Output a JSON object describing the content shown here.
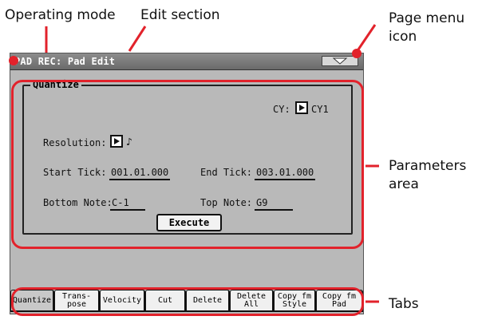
{
  "callouts": {
    "operating_mode": "Operating mode",
    "edit_section": "Edit section",
    "page_menu_icon_line1": "Page menu",
    "page_menu_icon_line2": "icon",
    "parameters_area_line1": "Parameters",
    "parameters_area_line2": "area",
    "tabs": "Tabs"
  },
  "screen": {
    "title": "PAD REC: Pad Edit",
    "panel_title": "Quantize",
    "cy_label": "CY:",
    "cy_value": "CY1",
    "resolution_label": "Resolution:",
    "resolution_value": "♪",
    "start_tick_label": "Start Tick:",
    "start_tick_value": "001.01.000",
    "end_tick_label": "End Tick:",
    "end_tick_value": "003.01.000",
    "bottom_note_label": "Bottom Note:",
    "bottom_note_value": "C-1",
    "top_note_label": "Top Note:",
    "top_note_value": "G9",
    "execute_label": "Execute",
    "tabs": [
      {
        "label": "Quantize",
        "active": true
      },
      {
        "label": "Trans-\npose",
        "active": false
      },
      {
        "label": "Velocity",
        "active": false
      },
      {
        "label": "Cut",
        "active": false
      },
      {
        "label": "Delete",
        "active": false
      },
      {
        "label": "Delete\nAll",
        "active": false
      },
      {
        "label": "Copy fm\nStyle",
        "active": false
      },
      {
        "label": "Copy fm\nPad",
        "active": false
      }
    ]
  },
  "colors": {
    "highlight": "#e2222b",
    "screen_bg": "#b9b9b9",
    "titlebar": "#7a7a7a"
  }
}
